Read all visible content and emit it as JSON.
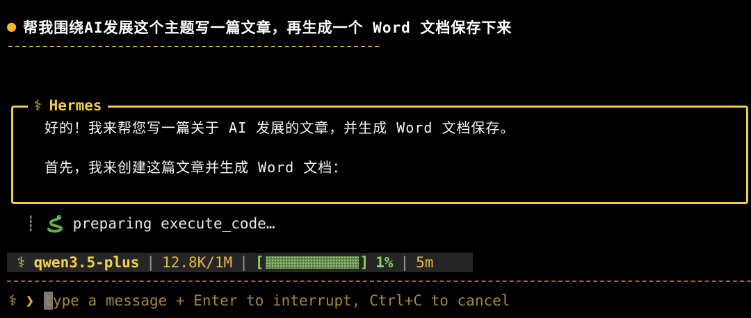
{
  "user_prompt": {
    "text": "帮我围绕AI发展这个主题写一篇文章，再生成一个 Word 文档保存下来"
  },
  "assistant": {
    "name": "Hermes",
    "icon": "staff-icon",
    "lines": [
      "好的！我来帮您写一篇关于 AI 发展的文章，并生成 Word 文档保存。",
      "首先，我来创建这篇文章并生成 Word 文档："
    ]
  },
  "tool": {
    "icon": "snake-icon",
    "text": "preparing execute_code…"
  },
  "status_bar": {
    "model": "qwen3.5-plus",
    "tokens": "12.8K/1M",
    "context_percent": "1%",
    "context_fraction": 0.01,
    "elapsed": "5m"
  },
  "input": {
    "placeholder": "type a message + Enter to interrupt, Ctrl+C to cancel"
  },
  "colors": {
    "accent_yellow": "#f2cc45",
    "progress_green": "#8fd16a",
    "divider_orange": "#a65b3c"
  }
}
